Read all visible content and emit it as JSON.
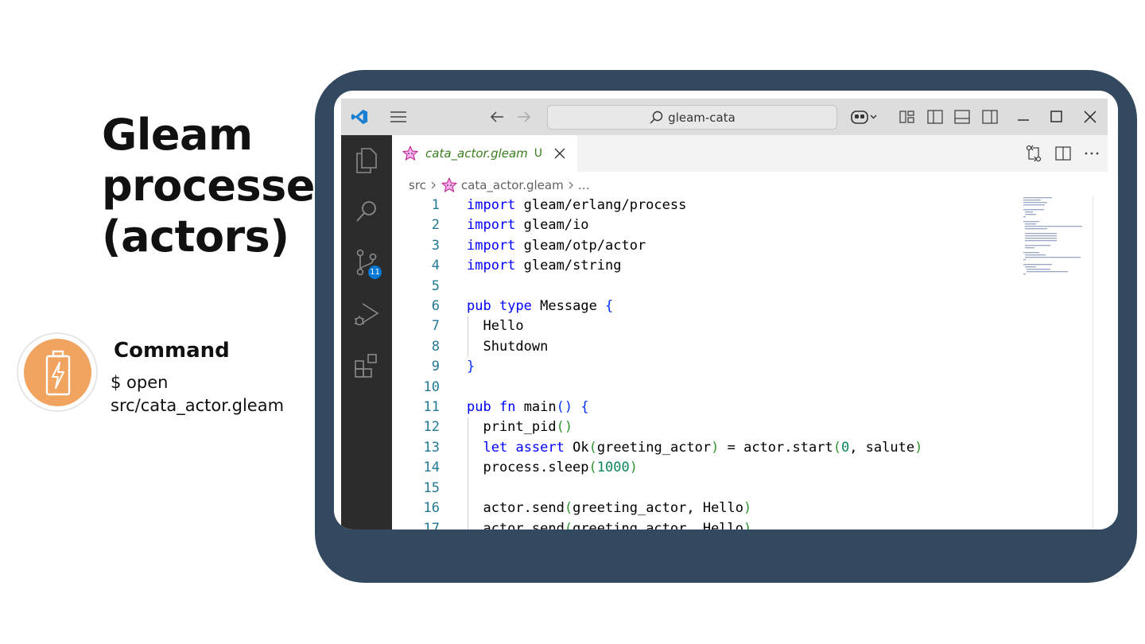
{
  "slide": {
    "title": "Gleam processes (actors)",
    "command_heading": "Command",
    "command_text": "$ open src/cata_actor.gleam",
    "accent_color": "#f0a460",
    "frame_color": "#33495f"
  },
  "titlebar": {
    "search_text": "gleam-cata",
    "icons": [
      "vscode-logo",
      "menu-icon",
      "back-arrow-icon",
      "forward-arrow-icon",
      "search-icon",
      "copilot-icon",
      "layout-icon",
      "toggle-sidebar-icon",
      "toggle-panel-icon",
      "toggle-secondary-sidebar-icon",
      "minimize-icon",
      "maximize-icon",
      "close-icon"
    ]
  },
  "activitybar": {
    "items": [
      "explorer-icon",
      "search-icon",
      "source-control-icon",
      "run-debug-icon",
      "extensions-icon"
    ],
    "source_control_badge": "11"
  },
  "tab": {
    "label": "cata_actor.gleam",
    "status": "U"
  },
  "breadcrumb": {
    "folder": "src",
    "file": "cata_actor.gleam",
    "more": "…"
  },
  "editor": {
    "line_numbers": [
      "1",
      "2",
      "3",
      "4",
      "5",
      "6",
      "7",
      "8",
      "9",
      "10",
      "11",
      "12",
      "13",
      "14",
      "15",
      "16",
      "17"
    ]
  }
}
